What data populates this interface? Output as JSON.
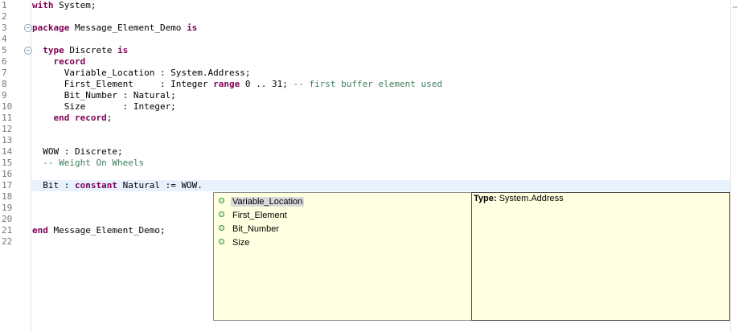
{
  "editor": {
    "lines": [
      {
        "n": "1",
        "parts": [
          {
            "t": "with",
            "c": "kw"
          },
          {
            "t": " System;",
            "c": ""
          }
        ]
      },
      {
        "n": "2",
        "parts": []
      },
      {
        "n": "3",
        "fold": "⊖",
        "parts": [
          {
            "t": "package",
            "c": "kw"
          },
          {
            "t": " Message_Element_Demo ",
            "c": ""
          },
          {
            "t": "is",
            "c": "kw"
          }
        ]
      },
      {
        "n": "4",
        "parts": []
      },
      {
        "n": "5",
        "fold": "⊖",
        "parts": [
          {
            "t": "  ",
            "c": ""
          },
          {
            "t": "type",
            "c": "kw"
          },
          {
            "t": " Discrete ",
            "c": ""
          },
          {
            "t": "is",
            "c": "kw"
          }
        ]
      },
      {
        "n": "6",
        "parts": [
          {
            "t": "    ",
            "c": ""
          },
          {
            "t": "record",
            "c": "kw"
          }
        ]
      },
      {
        "n": "7",
        "parts": [
          {
            "t": "      Variable_Location : System.Address;",
            "c": ""
          }
        ]
      },
      {
        "n": "8",
        "parts": [
          {
            "t": "      First_Element     : Integer ",
            "c": ""
          },
          {
            "t": "range",
            "c": "kw"
          },
          {
            "t": " 0 .. 31; ",
            "c": ""
          },
          {
            "t": "-- first buffer element used",
            "c": "cm"
          }
        ]
      },
      {
        "n": "9",
        "parts": [
          {
            "t": "      Bit_Number : Natural;",
            "c": ""
          }
        ]
      },
      {
        "n": "10",
        "parts": [
          {
            "t": "      Size       : Integer;",
            "c": ""
          }
        ]
      },
      {
        "n": "11",
        "parts": [
          {
            "t": "    ",
            "c": ""
          },
          {
            "t": "end record",
            "c": "kw"
          },
          {
            "t": ";",
            "c": ""
          }
        ]
      },
      {
        "n": "12",
        "parts": []
      },
      {
        "n": "13",
        "parts": []
      },
      {
        "n": "14",
        "parts": [
          {
            "t": "  WOW : Discrete;",
            "c": ""
          }
        ]
      },
      {
        "n": "15",
        "parts": [
          {
            "t": "  ",
            "c": ""
          },
          {
            "t": "-- Weight On Wheels",
            "c": "cm"
          }
        ]
      },
      {
        "n": "16",
        "parts": []
      },
      {
        "n": "17",
        "hl": true,
        "parts": [
          {
            "t": "  Bit : ",
            "c": ""
          },
          {
            "t": "constant",
            "c": "kw"
          },
          {
            "t": " Natural := WOW.",
            "c": ""
          }
        ]
      },
      {
        "n": "18",
        "parts": []
      },
      {
        "n": "19",
        "parts": []
      },
      {
        "n": "20",
        "parts": []
      },
      {
        "n": "21",
        "parts": [
          {
            "t": "end",
            "c": "kw"
          },
          {
            "t": " Message_Element_Demo;",
            "c": ""
          }
        ]
      },
      {
        "n": "22",
        "parts": []
      }
    ]
  },
  "content_assist": {
    "proposals": [
      {
        "label": "Variable_Location",
        "selected": true
      },
      {
        "label": "First_Element",
        "selected": false
      },
      {
        "label": "Bit_Number",
        "selected": false
      },
      {
        "label": "Size",
        "selected": false
      }
    ],
    "icon": "field-icon"
  },
  "info_popup": {
    "type_label": "Type:",
    "type_value": " System.Address"
  },
  "colors": {
    "keyword": "#7f0055",
    "comment": "#3f7f5f",
    "current_line": "#e8f2fe",
    "popup_bg": "#ffffe1"
  }
}
